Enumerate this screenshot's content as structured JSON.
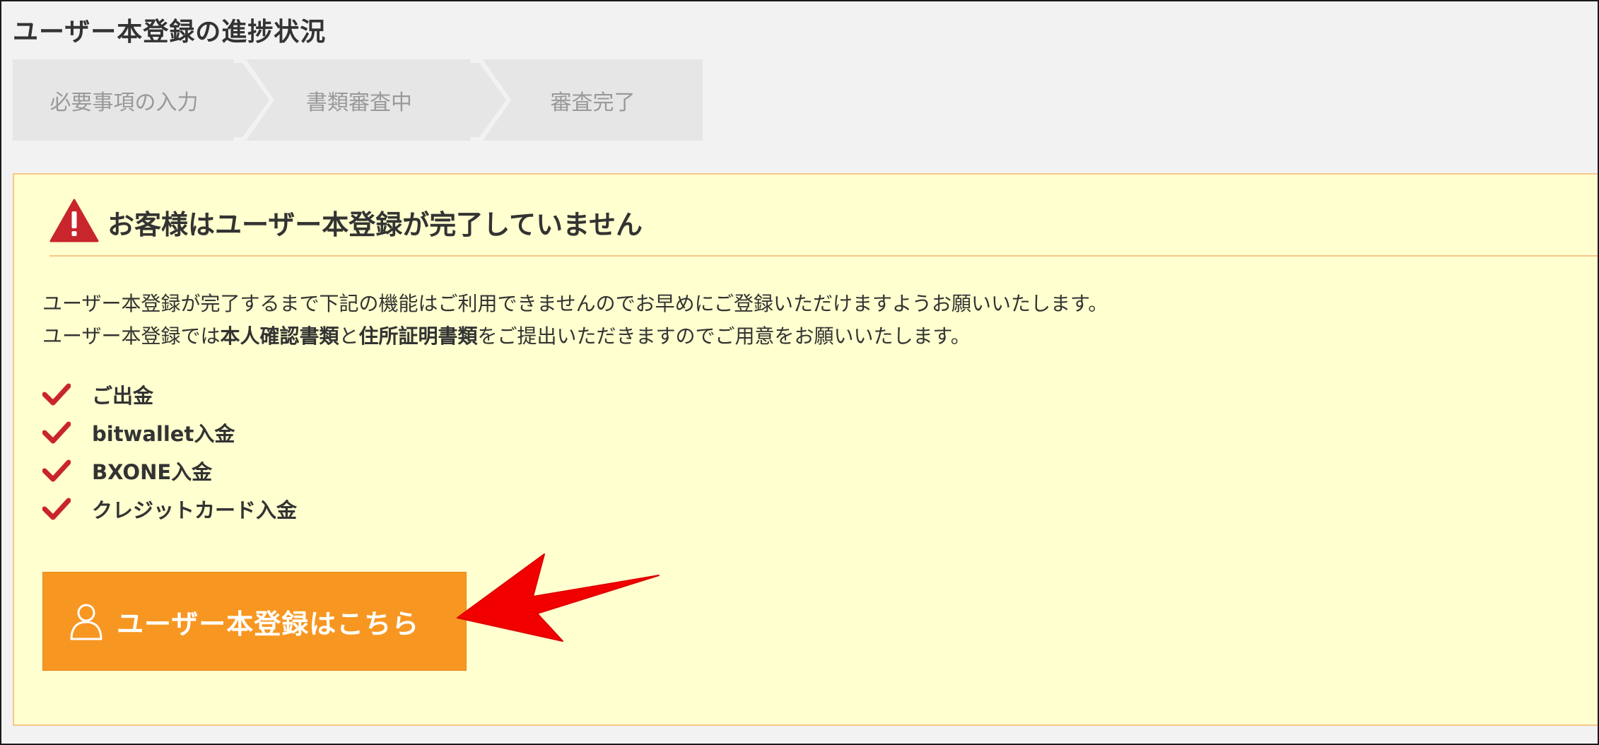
{
  "page_title": "ユーザー本登録の進捗状況",
  "steps": [
    {
      "label": "必要事項の入力"
    },
    {
      "label": "書類審査中"
    },
    {
      "label": "審査完了"
    }
  ],
  "alert": {
    "title": "お客様はユーザー本登録が完了していません",
    "line1": "ユーザー本登録が完了するまで下記の機能はご利用できませんのでお早めにご登録いただけますようお願いいたします。",
    "line2_pre": "ユーザー本登録では",
    "line2_bold1": "本人確認書類",
    "line2_mid": "と",
    "line2_bold2": "住所証明書類",
    "line2_post": "をご提出いただきますのでご用意をお願いいたします。"
  },
  "features": [
    {
      "label": "ご出金"
    },
    {
      "label": "bitwallet入金"
    },
    {
      "label": "BXONE入金"
    },
    {
      "label": "クレジットカード入金"
    }
  ],
  "register_button": {
    "label": "ユーザー本登録はこちら"
  },
  "colors": {
    "accent_orange": "#f79721",
    "alert_bg": "#ffffcf",
    "alert_border": "#f7c88a",
    "warning_red": "#c9252c",
    "arrow_red": "#f20000"
  },
  "icons": {
    "warning": "warning-triangle-icon",
    "check": "check-icon",
    "user": "user-icon",
    "annotation": "red-arrow"
  }
}
